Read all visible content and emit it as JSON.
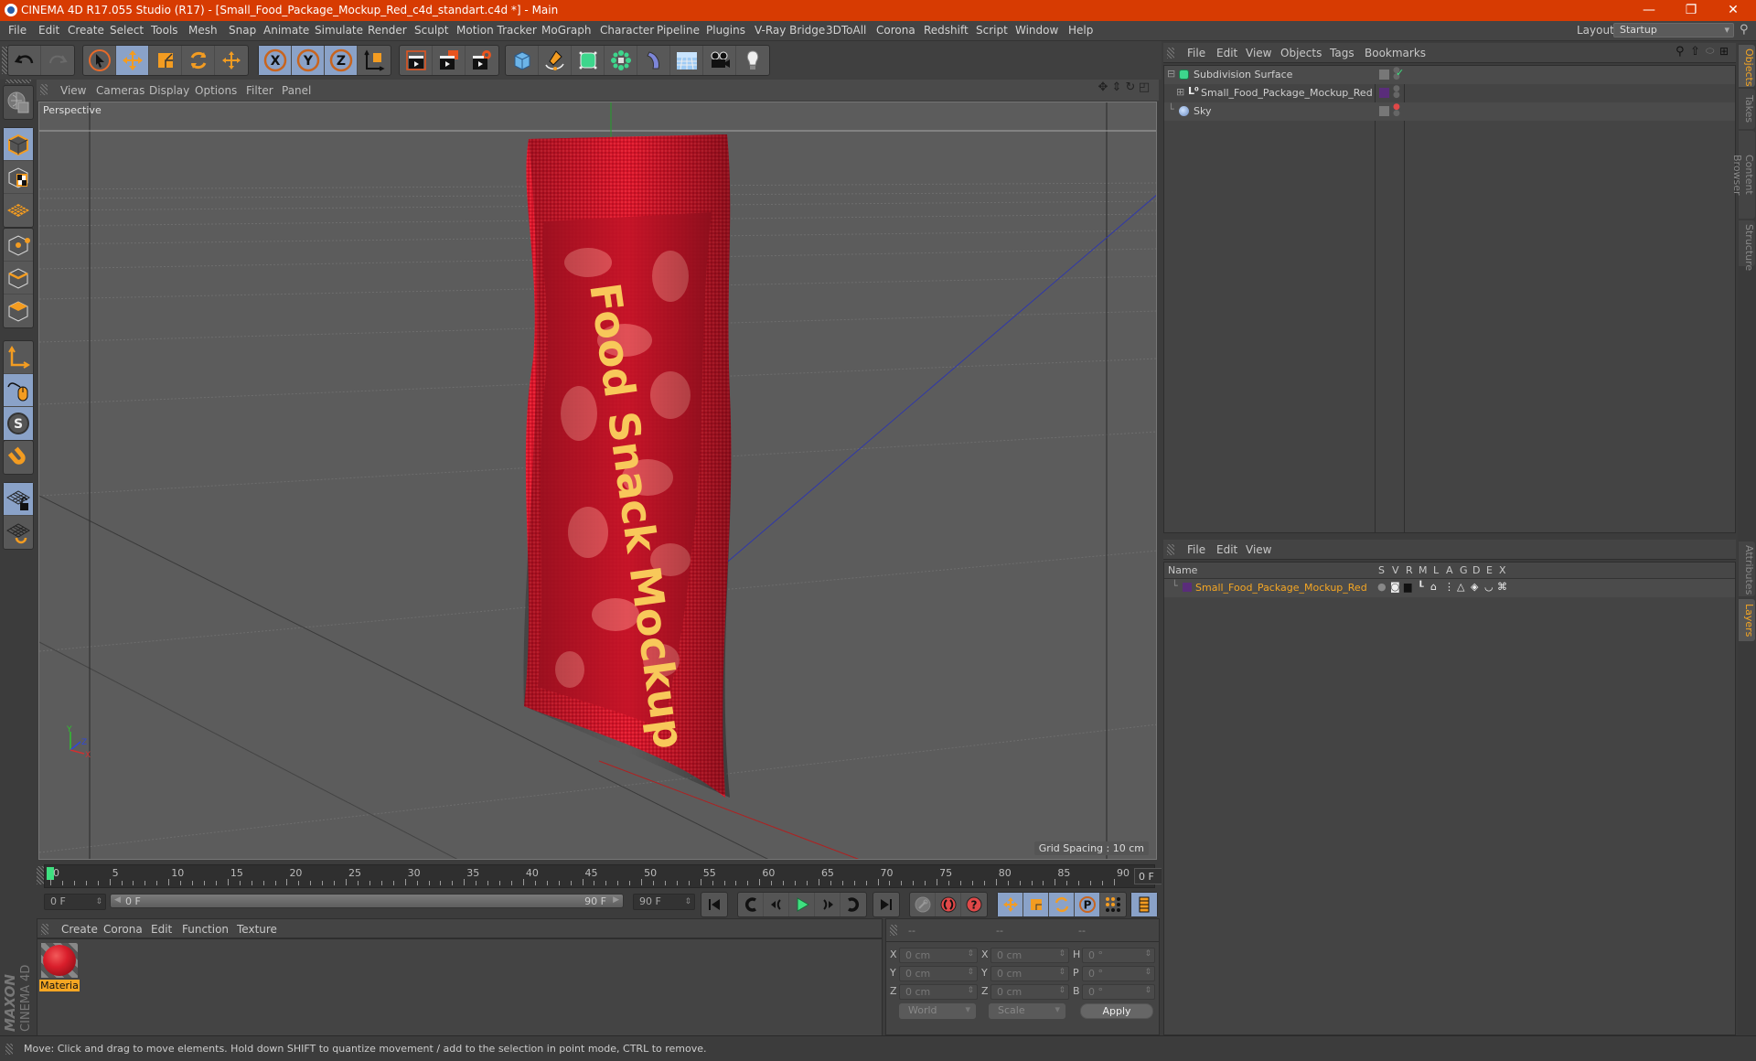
{
  "window": {
    "title": "CINEMA 4D R17.055 Studio (R17) - [Small_Food_Package_Mockup_Red_c4d_standart.c4d *] - Main",
    "controls": {
      "minimize": "—",
      "restore": "❐",
      "close": "✕"
    }
  },
  "menubar": {
    "items": [
      "File",
      "Edit",
      "Create",
      "Select",
      "Tools",
      "Mesh",
      "Snap",
      "Animate",
      "Simulate",
      "Render",
      "Sculpt",
      "Motion Tracker",
      "MoGraph",
      "Character",
      "Pipeline",
      "Plugins",
      "V-Ray Bridge",
      "3DToAll",
      "Corona",
      "Redshift",
      "Script",
      "Window",
      "Help"
    ],
    "layout_label": "Layout:",
    "layout_value": "Startup"
  },
  "toolbar": {
    "groups": [
      [
        "undo-icon",
        "redo-icon"
      ],
      [
        "select-icon",
        "move-icon",
        "scale-icon",
        "rotate-icon",
        "move-last-icon"
      ],
      [
        "x-axis-icon",
        "y-axis-icon",
        "z-axis-icon",
        "coordinate-system-icon"
      ],
      [
        "render-view-icon",
        "render-picture-viewer-icon",
        "render-settings-icon"
      ],
      [
        "cube-icon",
        "pen-icon",
        "subdivision-icon",
        "mograph-cloner-icon",
        "deformer-icon",
        "floor-icon",
        "camera-icon",
        "light-icon"
      ]
    ]
  },
  "left_tools": [
    "make-editable-icon",
    "model-mode-icon",
    "texture-mode-icon",
    "workplane-mode-icon",
    "points-mode-icon",
    "edges-mode-icon",
    "polygons-mode-icon",
    "axis-mode-icon",
    "tweak-mode-icon",
    "solo-icon",
    "snap-icon",
    "workplane-lock-icon",
    "workplane-align-icon"
  ],
  "viewport": {
    "menu": [
      "View",
      "Cameras",
      "Display",
      "Options",
      "Filter",
      "Panel"
    ],
    "label": "Perspective",
    "grid_spacing": "Grid Spacing : 10 cm",
    "nav_icons": [
      "pan-icon",
      "dolly-icon",
      "orbit-icon",
      "maximize-view-icon"
    ],
    "axis_labels": {
      "x": "X",
      "y": "Y",
      "z": "Z"
    },
    "package_text": "Food Snack Mockup"
  },
  "timeline": {
    "ticks": [
      "0",
      "5",
      "10",
      "15",
      "20",
      "25",
      "30",
      "35",
      "40",
      "45",
      "50",
      "55",
      "60",
      "65",
      "70",
      "75",
      "80",
      "85",
      "90"
    ],
    "current_frame": "0 F",
    "start_field": "0 F",
    "range_start": "0 F",
    "range_end": "90 F",
    "end_field": "90 F",
    "min_frame": 0,
    "max_frame": 90
  },
  "playback": {
    "buttons": [
      "go-to-start-icon",
      "previous-key-icon",
      "previous-frame-icon",
      "play-icon",
      "next-frame-icon",
      "next-key-icon",
      "go-to-end-icon"
    ],
    "record": [
      "motion-clip-icon",
      "autokey-icon",
      "keyframe-selection-icon"
    ],
    "key_tracks": [
      "key-position-icon",
      "key-scale-icon",
      "key-rotation-icon",
      "key-parameter-icon",
      "key-pla-icon"
    ],
    "timeline_btn": "timeline-icon"
  },
  "material_manager": {
    "menu": [
      "Create",
      "Corona",
      "Edit",
      "Function",
      "Texture"
    ],
    "materials": [
      {
        "name": "Materia"
      }
    ]
  },
  "coordinates": {
    "headers": [
      "--",
      "--",
      "--"
    ],
    "rows": [
      {
        "l1": "X",
        "v1": "0 cm",
        "l2": "X",
        "v2": "0 cm",
        "l3": "H",
        "v3": "0 °"
      },
      {
        "l1": "Y",
        "v1": "0 cm",
        "l2": "Y",
        "v2": "0 cm",
        "l3": "P",
        "v3": "0 °"
      },
      {
        "l1": "Z",
        "v1": "0 cm",
        "l2": "Z",
        "v2": "0 cm",
        "l3": "B",
        "v3": "0 °"
      }
    ],
    "space": "World",
    "mode": "Scale",
    "apply": "Apply"
  },
  "object_manager": {
    "menu": [
      "File",
      "Edit",
      "View",
      "Objects",
      "Tags",
      "Bookmarks"
    ],
    "objects": [
      {
        "name": "Subdivision Surface",
        "icon": "subdivision-icon",
        "expanded": true
      },
      {
        "name": "Small_Food_Package_Mockup_Red",
        "icon": "null-object-icon",
        "layer_color": "#5a2d7a"
      },
      {
        "name": "Sky",
        "icon": "sky-icon"
      }
    ]
  },
  "layer_manager": {
    "menu": [
      "File",
      "Edit",
      "View"
    ],
    "columns": [
      "Name",
      "S",
      "V",
      "R",
      "M",
      "L",
      "A",
      "G",
      "D",
      "E",
      "X"
    ],
    "layers": [
      {
        "name": "Small_Food_Package_Mockup_Red",
        "color": "#5a2d7a"
      }
    ]
  },
  "side_tabs": {
    "top": [
      "Objects",
      "Takes",
      "Content Browser",
      "Structure"
    ],
    "bottom": [
      "Attributes",
      "Layers"
    ]
  },
  "status": "Move: Click and drag to move elements. Hold down SHIFT to quantize movement / add to the selection in point mode, CTRL to remove.",
  "colors": {
    "accent": "#f5a623",
    "titlebar": "#d73b02",
    "active_button": "#8aa2c8",
    "bag_red": "#d8162a"
  }
}
